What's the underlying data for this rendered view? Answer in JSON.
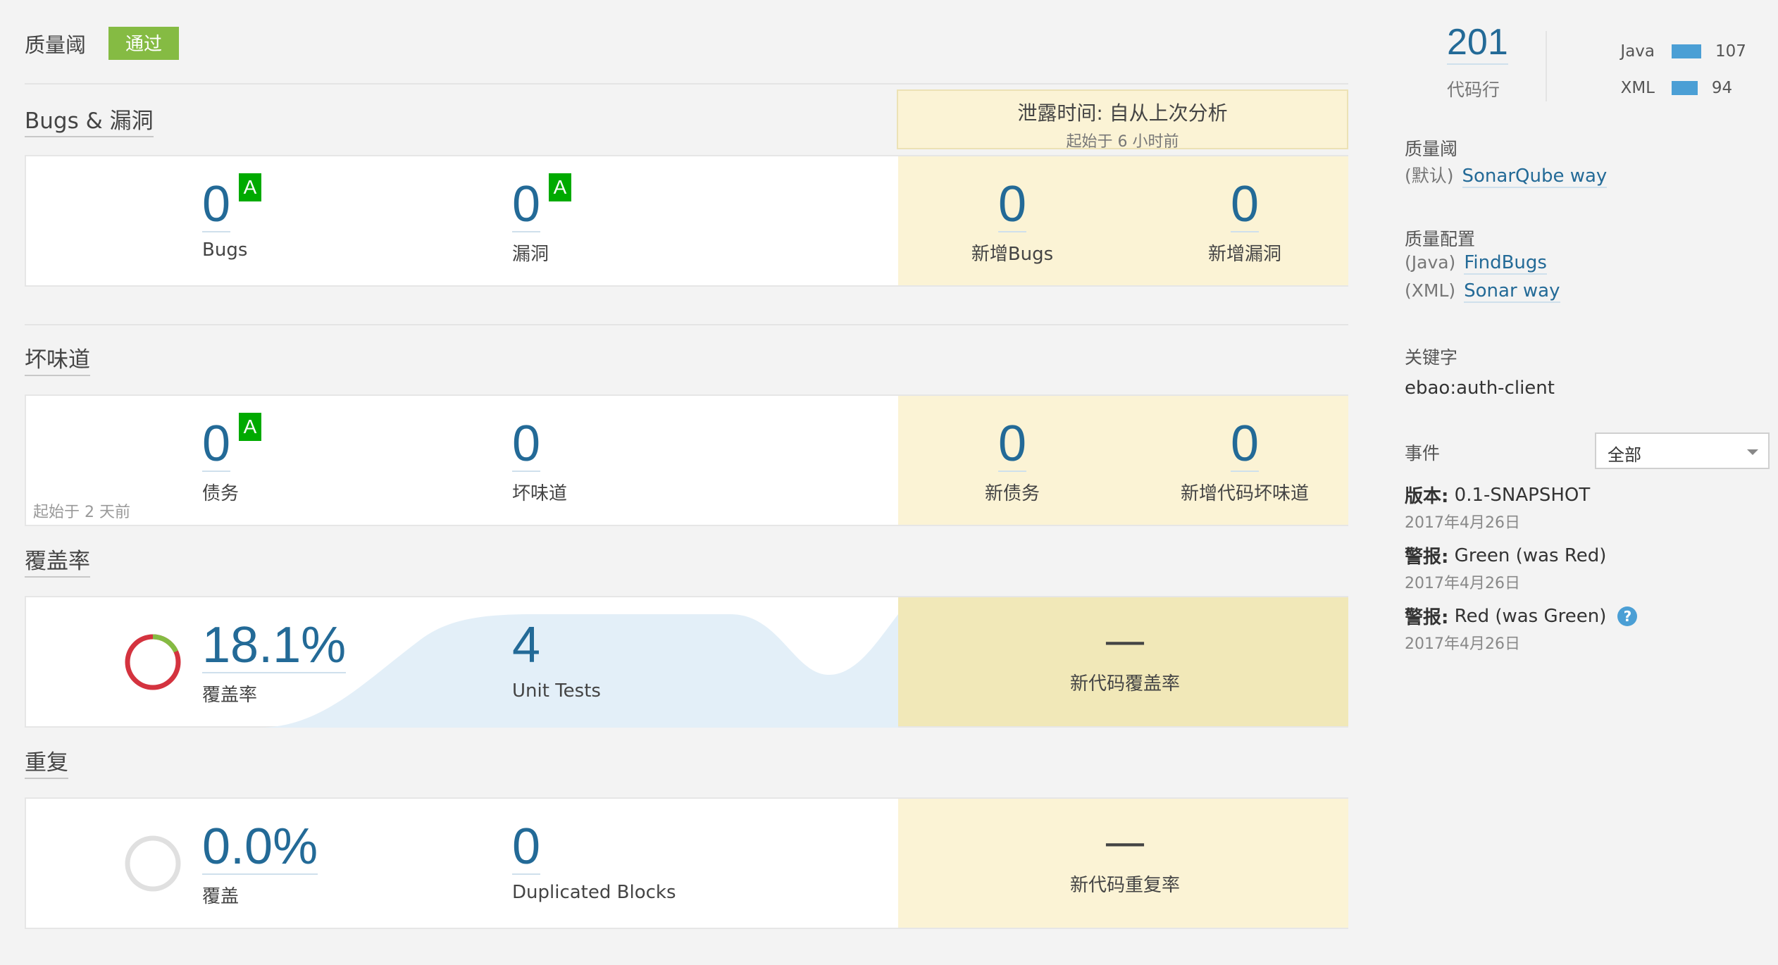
{
  "quality_gate": {
    "title": "质量阈",
    "status": "通过"
  },
  "leak_period": {
    "title": "泄露时间: 自从上次分析",
    "subtitle": "起始于 6 小时前"
  },
  "bugs_section": {
    "title": "Bugs & 漏洞",
    "bugs": {
      "value": "0",
      "label": "Bugs",
      "rating": "A"
    },
    "vulnerabilities": {
      "value": "0",
      "label": "漏洞",
      "rating": "A"
    },
    "new_bugs": {
      "value": "0",
      "label": "新增Bugs"
    },
    "new_vulnerabilities": {
      "value": "0",
      "label": "新增漏洞"
    }
  },
  "code_smells_section": {
    "title": "坏味道",
    "debt": {
      "value": "0",
      "label": "债务",
      "rating": "A"
    },
    "smells": {
      "value": "0",
      "label": "坏味道"
    },
    "since_note": "起始于 2 天前",
    "new_debt": {
      "value": "0",
      "label": "新债务"
    },
    "new_smells": {
      "value": "0",
      "label": "新增代码坏味道"
    }
  },
  "coverage_section": {
    "title": "覆盖率",
    "coverage": {
      "value": "18.1%",
      "label": "覆盖率",
      "percent": 18.1
    },
    "unit_tests": {
      "value": "4",
      "label": "Unit Tests"
    },
    "new_coverage": {
      "value": "—",
      "label": "新代码覆盖率"
    }
  },
  "duplications_section": {
    "title": "重复",
    "duplications": {
      "value": "0.0%",
      "label": "覆盖",
      "percent": 0.0
    },
    "duplicated_blocks": {
      "value": "0",
      "label": "Duplicated Blocks"
    },
    "new_duplications": {
      "value": "—",
      "label": "新代码重复率"
    }
  },
  "sidebar": {
    "lines_of_code": {
      "value": "201",
      "label": "代码行"
    },
    "languages": [
      {
        "name": "Java",
        "count": 107
      },
      {
        "name": "XML",
        "count": 94
      }
    ],
    "quality_gate": {
      "label": "质量阈",
      "prefix": "(默认)",
      "link": "SonarQube way"
    },
    "quality_profiles": {
      "label": "质量配置",
      "items": [
        {
          "prefix": "(Java)",
          "link": "FindBugs"
        },
        {
          "prefix": "(XML)",
          "link": "Sonar way"
        }
      ]
    },
    "key": {
      "label": "关键字",
      "value": "ebao:auth-client"
    },
    "events": {
      "label": "事件",
      "filter": "全部",
      "items": [
        {
          "type": "版本:",
          "text": "0.1-SNAPSHOT",
          "date": "2017年4月26日"
        },
        {
          "type": "警报:",
          "text": "Green (was Red)",
          "date": "2017年4月26日"
        },
        {
          "type": "警报:",
          "text": "Red (was Green)",
          "date": "2017年4月26日",
          "help": "?"
        }
      ]
    }
  },
  "colors": {
    "measure_blue": "#236a97",
    "pass_green": "#85bb43",
    "rating_a": "#00aa00",
    "leak_bg": "#fbf3d5",
    "coverage_red": "#d4333f",
    "coverage_green": "#85bb43",
    "bar_blue": "#4b9fd5"
  }
}
